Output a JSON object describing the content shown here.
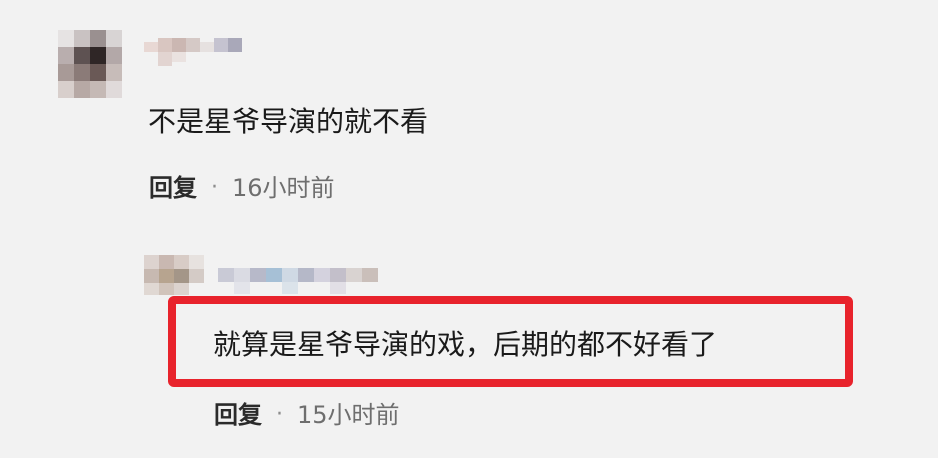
{
  "comments": [
    {
      "text": "不是星爷导演的就不看",
      "reply_label": "回复",
      "separator": "·",
      "time": "16小时前"
    },
    {
      "text": "就算是星爷导演的戏，后期的都不好看了",
      "reply_label": "回复",
      "separator": "·",
      "time": "15小时前",
      "highlight_color": "#e8232c"
    }
  ],
  "colors": {
    "background": "#f2f2f2",
    "text": "#1a1a1a",
    "meta": "#6e6e6e",
    "highlight": "#e8232c"
  }
}
